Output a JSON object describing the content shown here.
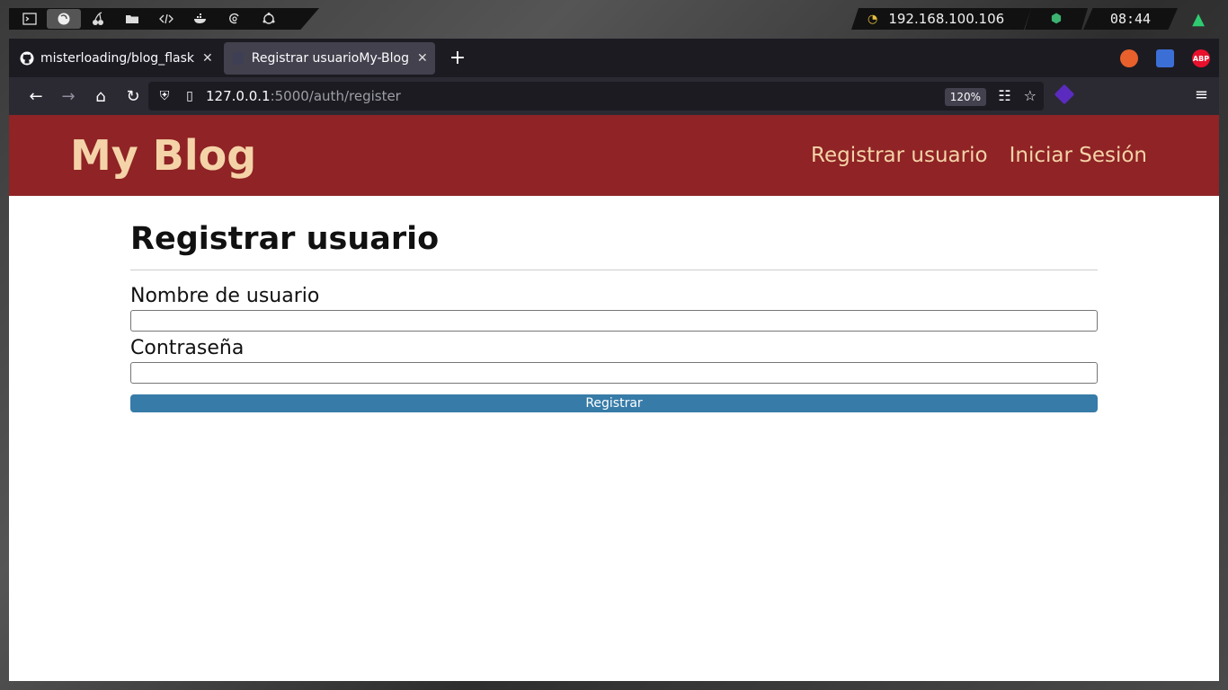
{
  "system_bar": {
    "ip_address": "192.168.100.106",
    "clock": "08:44"
  },
  "tabs": [
    {
      "title": "misterloading/blog_flask",
      "active": false
    },
    {
      "title": "Registrar usuarioMy-Blog",
      "active": true
    }
  ],
  "extensions": [
    {
      "name": "fox-extension-icon",
      "label": "",
      "color": "#e8602c"
    },
    {
      "name": "translate-extension-icon",
      "label": "",
      "color": "#3b6fd6"
    },
    {
      "name": "abp-extension-icon",
      "label": "ABP",
      "color": "#e8102c"
    }
  ],
  "url": {
    "host": "127.0.0.1",
    "rest": ":5000/auth/register"
  },
  "zoom": "120%",
  "site": {
    "title": "My Blog",
    "nav": {
      "register": "Registrar usuario",
      "login": "Iniciar Sesión"
    }
  },
  "form": {
    "heading": "Registrar usuario",
    "username_label": "Nombre de usuario",
    "username_value": "",
    "password_label": "Contraseña",
    "password_value": "",
    "submit_label": "Registrar"
  },
  "colors": {
    "header_bg": "#8f2325",
    "header_text": "#f5d3a8",
    "button_bg": "#377ba8"
  }
}
